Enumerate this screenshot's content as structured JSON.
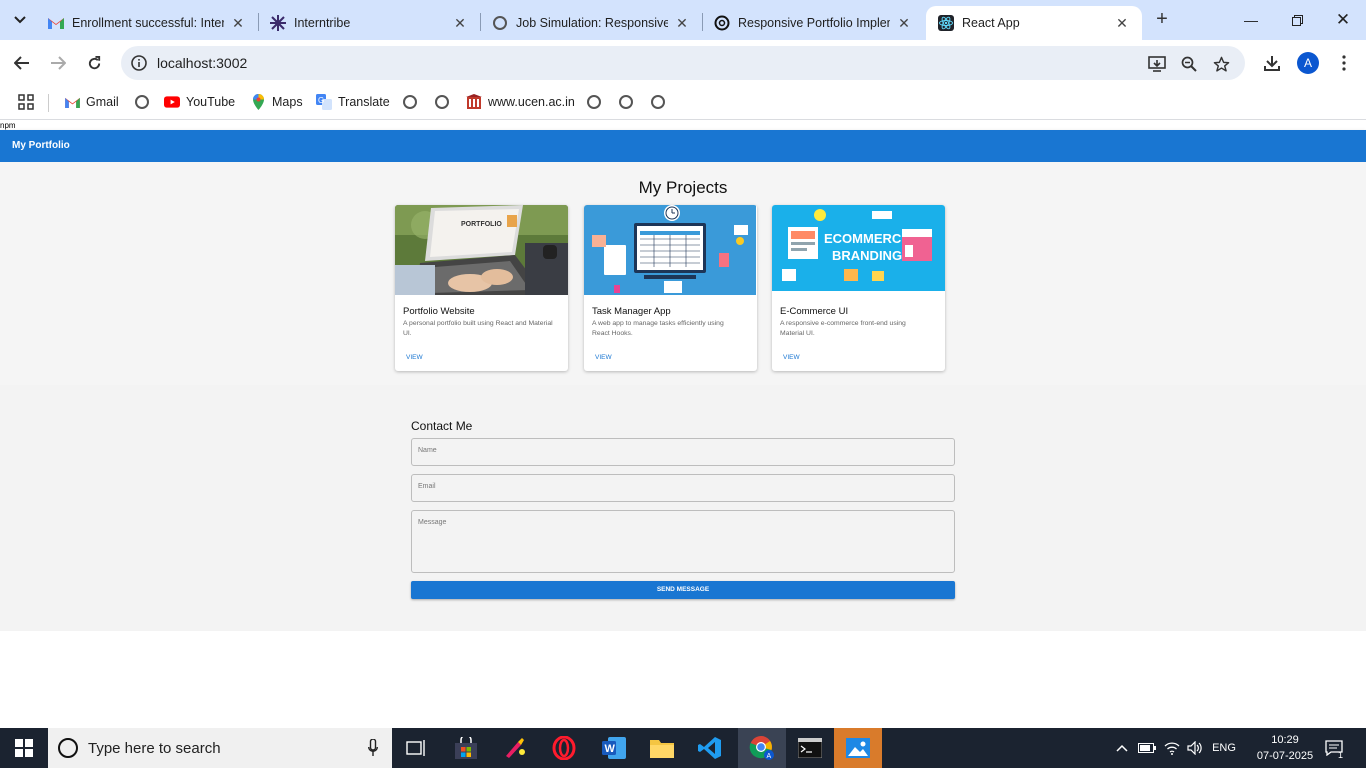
{
  "browser": {
    "tabs": [
      {
        "title": "Enrollment successful: Intern",
        "icon": "gmail-icon"
      },
      {
        "title": "Interntribe",
        "icon": "interntribe-icon"
      },
      {
        "title": "Job Simulation: Responsive P",
        "icon": "globe-icon"
      },
      {
        "title": "Responsive Portfolio Implem",
        "icon": "openai-icon"
      },
      {
        "title": "React App",
        "icon": "react-icon"
      }
    ],
    "url": "localhost:3002",
    "profile_initial": "A",
    "bookmarks": {
      "gmail": "Gmail",
      "youtube": "YouTube",
      "maps": "Maps",
      "translate": "Translate",
      "ucen": "www.ucen.ac.in"
    }
  },
  "page": {
    "stray_text": "npm",
    "brand": "My Portfolio",
    "projects_heading": "My Projects",
    "projects": [
      {
        "title": "Portfolio Website",
        "description": "A personal portfolio built using React and Material UI.",
        "action": "VIEW"
      },
      {
        "title": "Task Manager App",
        "description": "A web app to manage tasks efficiently using React Hooks.",
        "action": "VIEW"
      },
      {
        "title": "E-Commerce UI",
        "description": "A responsive e-commerce front-end using Material UI.",
        "action": "VIEW"
      }
    ],
    "contact": {
      "heading": "Contact Me",
      "name_placeholder": "Name",
      "email_placeholder": "Email",
      "message_placeholder": "Message",
      "submit_label": "SEND MESSAGE"
    },
    "image_texts": {
      "portfolio": "PORTFOLIO",
      "ecommerce_line1": "ECOMMERCE",
      "ecommerce_line2": "BRANDING"
    }
  },
  "taskbar": {
    "search_placeholder": "Type here to search",
    "language": "ENG",
    "time": "10:29",
    "date": "07-07-2025",
    "notification_count": "1"
  },
  "colors": {
    "primary": "#1976d2",
    "tabstrip": "#d3e3fd",
    "taskbar": "#1b2330"
  }
}
